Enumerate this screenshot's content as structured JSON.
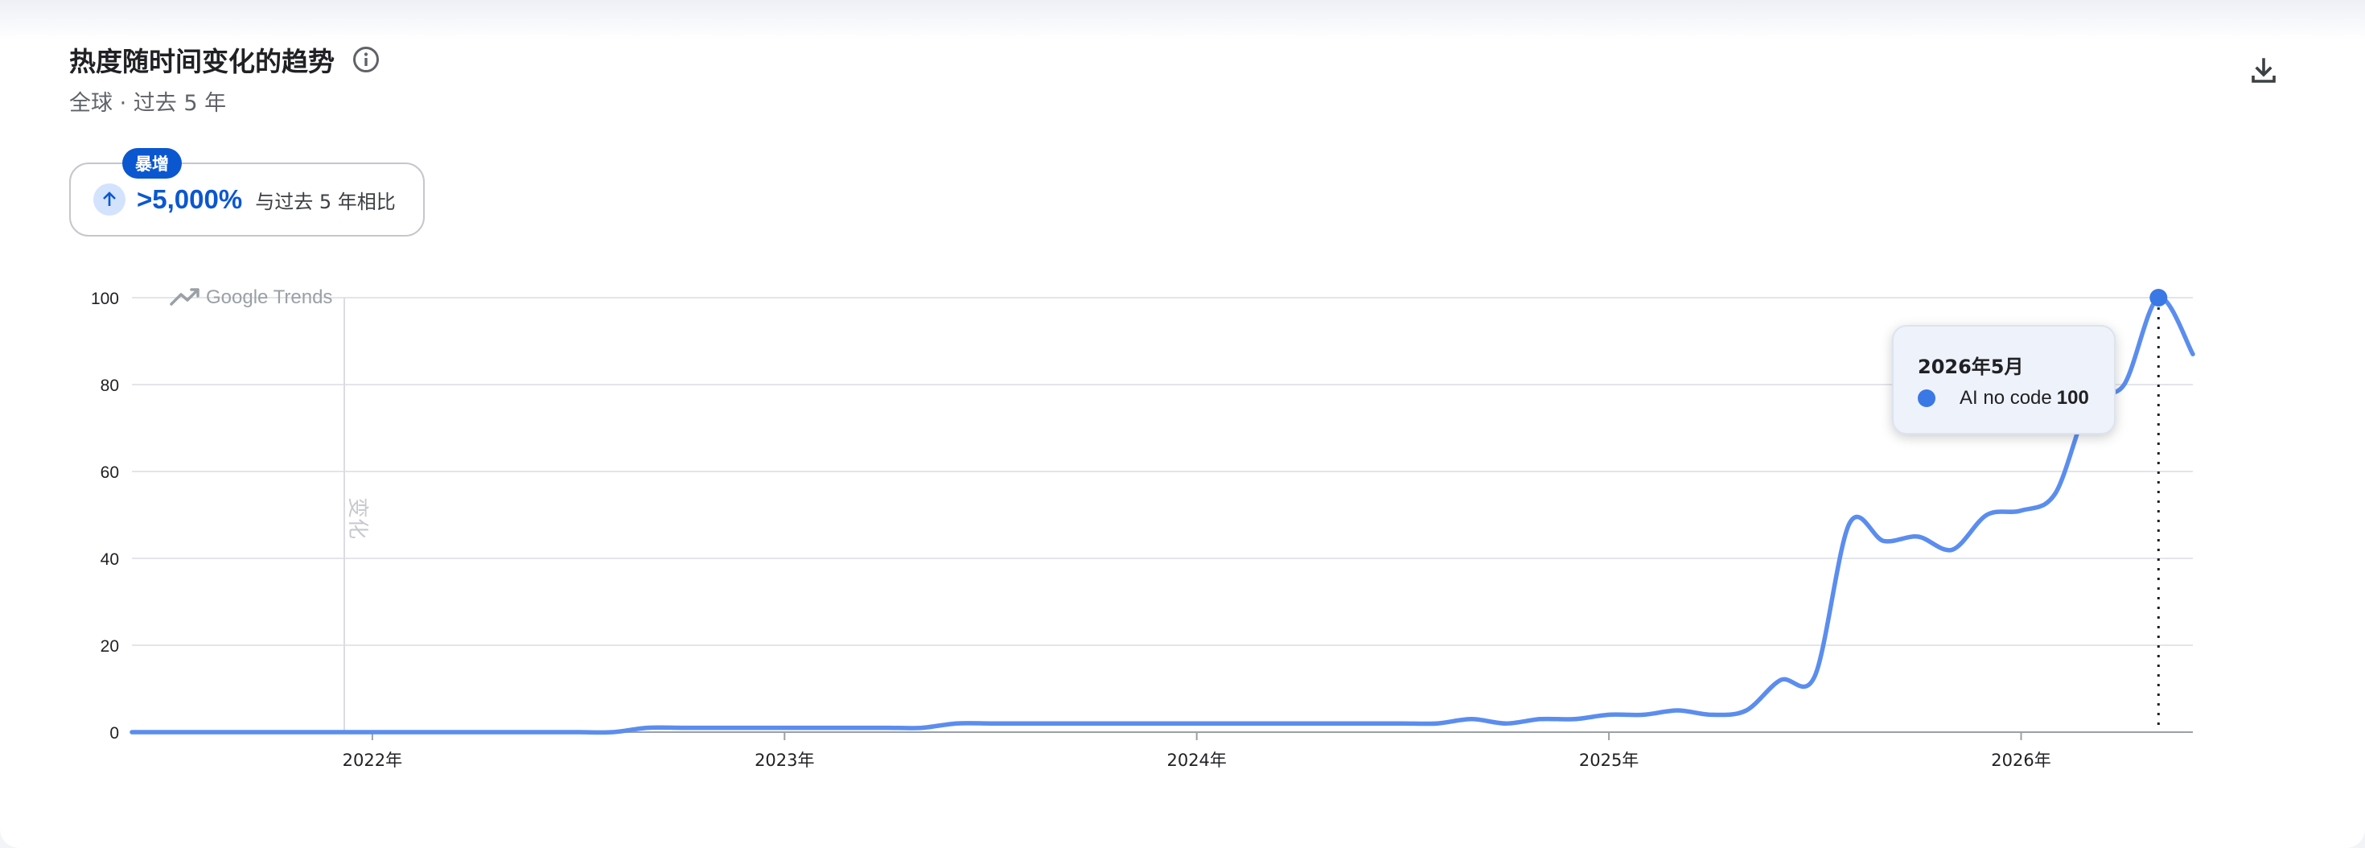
{
  "header": {
    "title": "热度随时间变化的趋势",
    "subtitle": "全球 · 过去 5 年"
  },
  "icons": {
    "info": "info-icon",
    "download": "download-icon",
    "arrow": "arrow-up-icon",
    "watermark": "google-trends-icon"
  },
  "stat": {
    "badge": "暴增",
    "value": ">5,000%",
    "caption": "与过去 5 年相比"
  },
  "watermark": "Google Trends",
  "annotation_label": "变化",
  "colors": {
    "line": "#5b8def",
    "accent": "#0b57d0",
    "tooltip_dot": "#3a78e6"
  },
  "tooltip": {
    "date": "2026年5月",
    "series": "AI no code",
    "value": "100"
  },
  "chart_data": {
    "type": "line",
    "title": "热度随时间变化的趋势",
    "xlabel": "",
    "ylabel": "",
    "ylim": [
      0,
      100
    ],
    "yticks": [
      0,
      20,
      40,
      60,
      80,
      100
    ],
    "xticks": [
      "2022年",
      "2023年",
      "2024年",
      "2025年",
      "2026年"
    ],
    "grid": true,
    "legend": "none",
    "x_start": "2021-06",
    "x_end": "2026-06",
    "series": [
      {
        "name": "AI no code",
        "values": [
          0,
          0,
          0,
          0,
          0,
          0,
          0,
          0,
          0,
          0,
          0,
          0,
          0,
          0,
          0,
          1,
          1,
          1,
          1,
          1,
          1,
          1,
          1,
          1,
          2,
          2,
          2,
          2,
          2,
          2,
          2,
          2,
          2,
          2,
          2,
          2,
          2,
          2,
          2,
          3,
          2,
          3,
          3,
          4,
          4,
          5,
          4,
          5,
          12,
          13,
          48,
          44,
          45,
          42,
          50,
          51,
          55,
          76,
          80,
          100,
          87
        ]
      }
    ],
    "highlight": {
      "x": "2026-05",
      "value": 100
    }
  }
}
